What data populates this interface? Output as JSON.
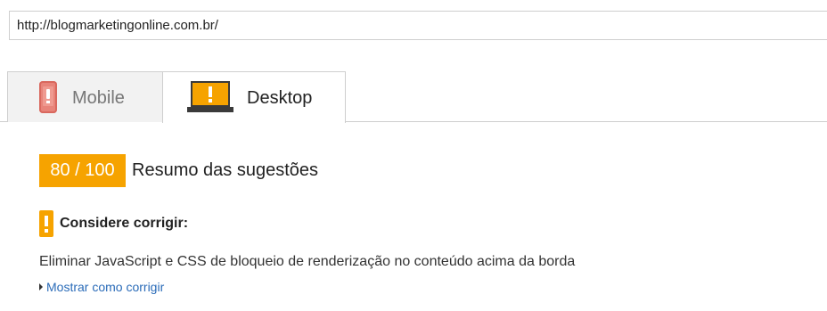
{
  "url_bar": {
    "value": "http://blogmarketingonline.com.br/"
  },
  "tabs": [
    {
      "label": "Mobile",
      "icon": "mobile-phone-warning-icon",
      "active": false
    },
    {
      "label": "Desktop",
      "icon": "laptop-warning-icon",
      "active": true
    }
  ],
  "summary": {
    "score": "80 / 100",
    "title": "Resumo das sugestões"
  },
  "warning": {
    "label": "Considere corrigir:",
    "icon": "exclamation-warning-icon"
  },
  "rule": {
    "text": "Eliminar JavaScript e CSS de bloqueio de renderização no conteúdo acima da borda",
    "link": "Mostrar como corrigir"
  },
  "colors": {
    "accent": "#f6a300",
    "link": "#2a6bb8",
    "mobile_icon": "#e8847a"
  }
}
